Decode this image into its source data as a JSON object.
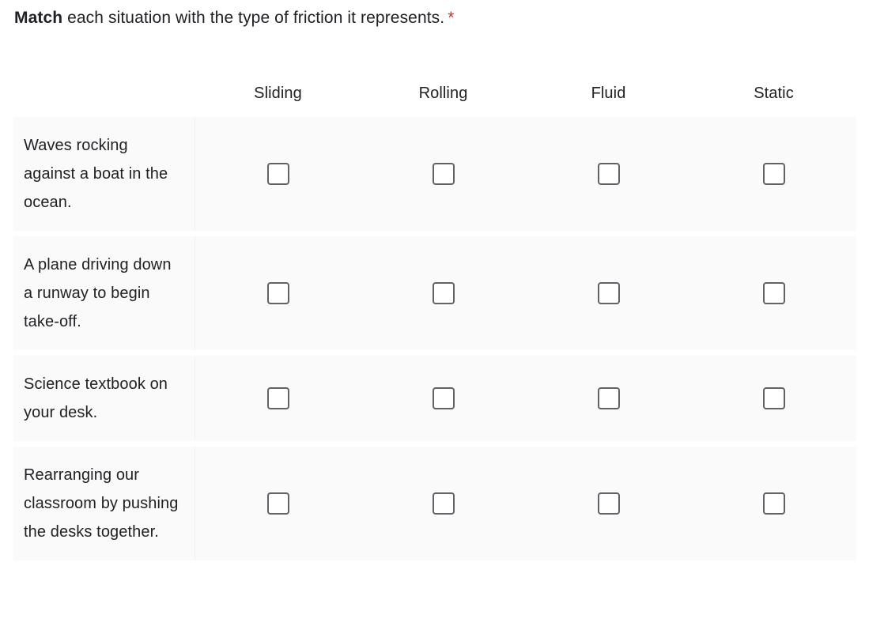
{
  "question": {
    "bold_lead": "Match",
    "rest": " each situation with the type of friction it represents.",
    "required_marker": "*",
    "required_color": "#d93025"
  },
  "grid": {
    "columns": [
      {
        "label": "Sliding"
      },
      {
        "label": "Rolling"
      },
      {
        "label": "Fluid"
      },
      {
        "label": "Static"
      }
    ],
    "rows": [
      {
        "label": "Waves rocking against a boat in the ocean.",
        "checked": [
          false,
          false,
          false,
          false
        ]
      },
      {
        "label": "A plane driving down a runway to begin take-off.",
        "checked": [
          false,
          false,
          false,
          false
        ]
      },
      {
        "label": "Science textbook on your desk.",
        "checked": [
          false,
          false,
          false,
          false
        ]
      },
      {
        "label": "Rearranging our classroom by pushing the desks together.",
        "checked": [
          false,
          false,
          false,
          false
        ]
      }
    ],
    "row_background": "#fafafa",
    "checkbox_border_color": "#5f6368",
    "text_color": "#202124"
  }
}
